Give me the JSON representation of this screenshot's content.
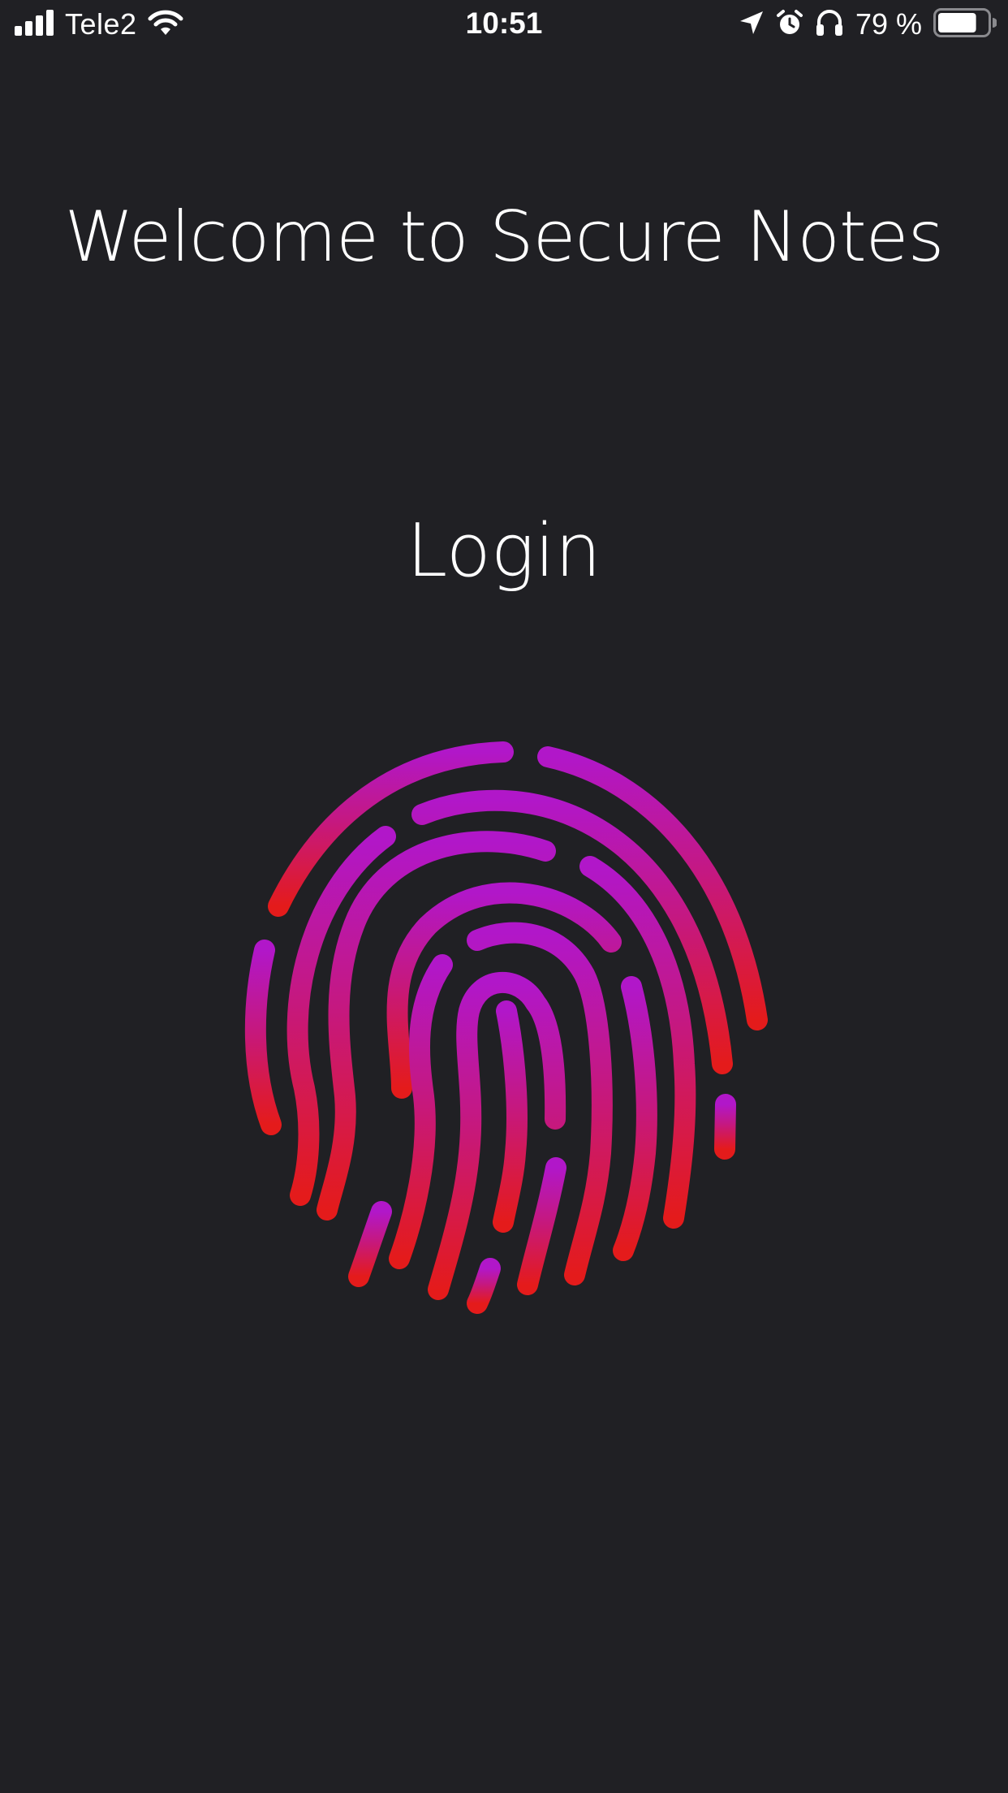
{
  "status_bar": {
    "carrier": "Tele2",
    "time": "10:51",
    "battery_percent": "79 %",
    "battery_level": 0.79,
    "icons": [
      "signal-icon",
      "wifi-icon",
      "location-arrow-icon",
      "alarm-icon",
      "headphones-icon",
      "battery-icon"
    ]
  },
  "main": {
    "title": "Welcome to Secure Notes",
    "login_label": "Login"
  },
  "fingerprint": {
    "icon": "fingerprint-icon",
    "gradient_top": "#B117C9",
    "gradient_bottom": "#E41B1B"
  },
  "colors": {
    "background": "#202024",
    "text": "#FFFFFF"
  }
}
